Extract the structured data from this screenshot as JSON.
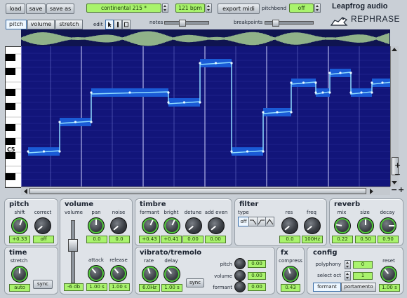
{
  "toolbar": {
    "load_label": "load",
    "save_label": "save",
    "save_as_label": "save as",
    "preset_name": "continental 215 *",
    "tempo": "121 bpm",
    "export_midi_label": "export midi",
    "pitchbend_label": "pitchbend",
    "pitchbend_value": "off",
    "notes_label": "notes",
    "breakpoints_label": "breakpoints",
    "edit_label": "edit"
  },
  "brand": {
    "company": "Leapfrog audio",
    "product": "REPHRASE"
  },
  "mode_tabs": [
    {
      "label": "pitch",
      "active": true
    },
    {
      "label": "volume",
      "active": false
    },
    {
      "label": "stretch",
      "active": false
    }
  ],
  "edit_tools": [
    "arrow-icon",
    "pencil-icon",
    "eraser-icon"
  ],
  "piano": {
    "c_label": "C5"
  },
  "editor": {
    "grid_color": "#12157a",
    "line_color": "#8fdcff",
    "note_color": "#1a5bd6",
    "notes": [
      {
        "start": 0.0,
        "end": 0.09,
        "pitch": 4
      },
      {
        "start": 0.09,
        "end": 0.18,
        "pitch": 7
      },
      {
        "start": 0.18,
        "end": 0.4,
        "pitch": 10
      },
      {
        "start": 0.4,
        "end": 0.49,
        "pitch": 9
      },
      {
        "start": 0.49,
        "end": 0.58,
        "pitch": 13
      },
      {
        "start": 0.58,
        "end": 0.67,
        "pitch": 4
      },
      {
        "start": 0.67,
        "end": 0.75,
        "pitch": 8
      },
      {
        "start": 0.75,
        "end": 0.82,
        "pitch": 11
      },
      {
        "start": 0.82,
        "end": 0.86,
        "pitch": 10
      },
      {
        "start": 0.86,
        "end": 0.92,
        "pitch": 12
      },
      {
        "start": 0.92,
        "end": 0.98,
        "pitch": 10
      },
      {
        "start": 0.98,
        "end": 1.04,
        "pitch": 11
      }
    ]
  },
  "panels": {
    "pitch": {
      "title": "pitch",
      "knobs": [
        {
          "label": "shift",
          "value": "+0.33"
        },
        {
          "label": "correct",
          "value": "off"
        }
      ]
    },
    "volume": {
      "title": "volume",
      "fader_label": "volume",
      "fader_value": "-6 db",
      "knobs": [
        {
          "label": "pan",
          "value": "0.0"
        },
        {
          "label": "noise",
          "value": "0.0"
        },
        {
          "label": "attack",
          "value": "1.00 s"
        },
        {
          "label": "release",
          "value": "1.00 s"
        }
      ]
    },
    "timbre": {
      "title": "timbre",
      "knobs": [
        {
          "label": "formant",
          "value": "+0.43"
        },
        {
          "label": "bright",
          "value": "+0.41"
        },
        {
          "label": "detune",
          "value": "0.00"
        },
        {
          "label": "add even",
          "value": "0.00"
        }
      ]
    },
    "filter": {
      "title": "filter",
      "type_label": "type",
      "type_value": "off",
      "knobs": [
        {
          "label": "res",
          "value": "0.0"
        },
        {
          "label": "freq",
          "value": "100Hz"
        }
      ]
    },
    "reverb": {
      "title": "reverb",
      "knobs": [
        {
          "label": "mix",
          "value": "0.22"
        },
        {
          "label": "size",
          "value": "0.50"
        },
        {
          "label": "decay",
          "value": "0.90"
        }
      ]
    },
    "time": {
      "title": "time",
      "knob_label": "stretch",
      "knob_value": "auto",
      "sync_label": "sync"
    },
    "vibrato": {
      "title": "vibrato/tremolo",
      "knobs": [
        {
          "label": "rate",
          "value": "6.0Hz"
        },
        {
          "label": "delay",
          "value": "1.00 s"
        }
      ],
      "sync_label": "sync",
      "depths": [
        {
          "label": "pitch",
          "value": "0.00"
        },
        {
          "label": "volume",
          "value": "0.00"
        },
        {
          "label": "formant",
          "value": "0.00"
        }
      ]
    },
    "fx": {
      "title": "fx",
      "knob_label": "compress",
      "knob_value": "0.43"
    },
    "config": {
      "title": "config",
      "polyphony_label": "polyphony",
      "polyphony_value": "0",
      "select_oct_label": "select oct",
      "select_oct_value": "1",
      "reset_label": "reset",
      "reset_value": "1.00 s",
      "formant_label": "formant",
      "portamento_label": "portamento"
    }
  }
}
